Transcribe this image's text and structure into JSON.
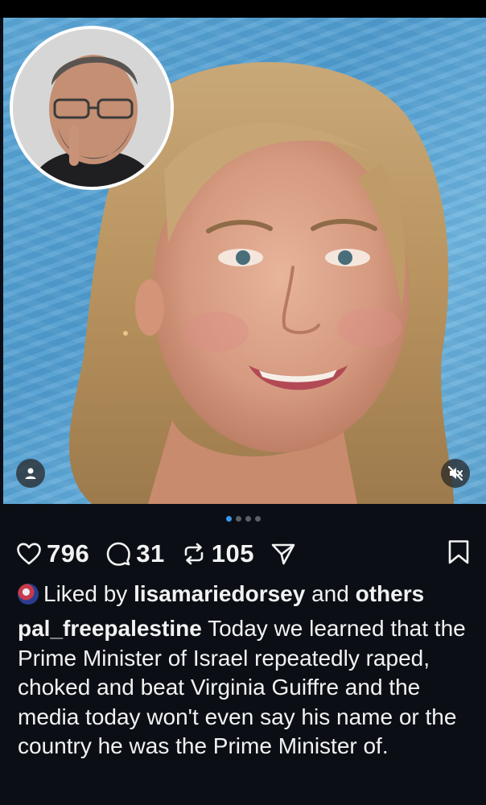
{
  "post": {
    "carousel": {
      "count": 4,
      "active_index": 0
    },
    "actions": {
      "likes": "796",
      "comments": "31",
      "reposts": "105"
    },
    "liked_by": {
      "prefix": "Liked by",
      "username": "lisamariedorsey",
      "connector": "and",
      "others": "others"
    },
    "caption": {
      "username": "pal_freepalestine",
      "text": "Today we learned that the Prime Minister of Israel repeatedly raped, choked and beat Virginia Guiffre and the media today won't even say his name or the country he was the Prime Minister of."
    },
    "icons": [
      "heart-icon",
      "comment-icon",
      "repost-icon",
      "share-icon",
      "bookmark-icon",
      "user-tag-icon",
      "muted-speaker-icon"
    ],
    "colors": {
      "background": "#0b0f15",
      "accent_dot": "#3897f0",
      "text": "#f2f2f2"
    }
  }
}
